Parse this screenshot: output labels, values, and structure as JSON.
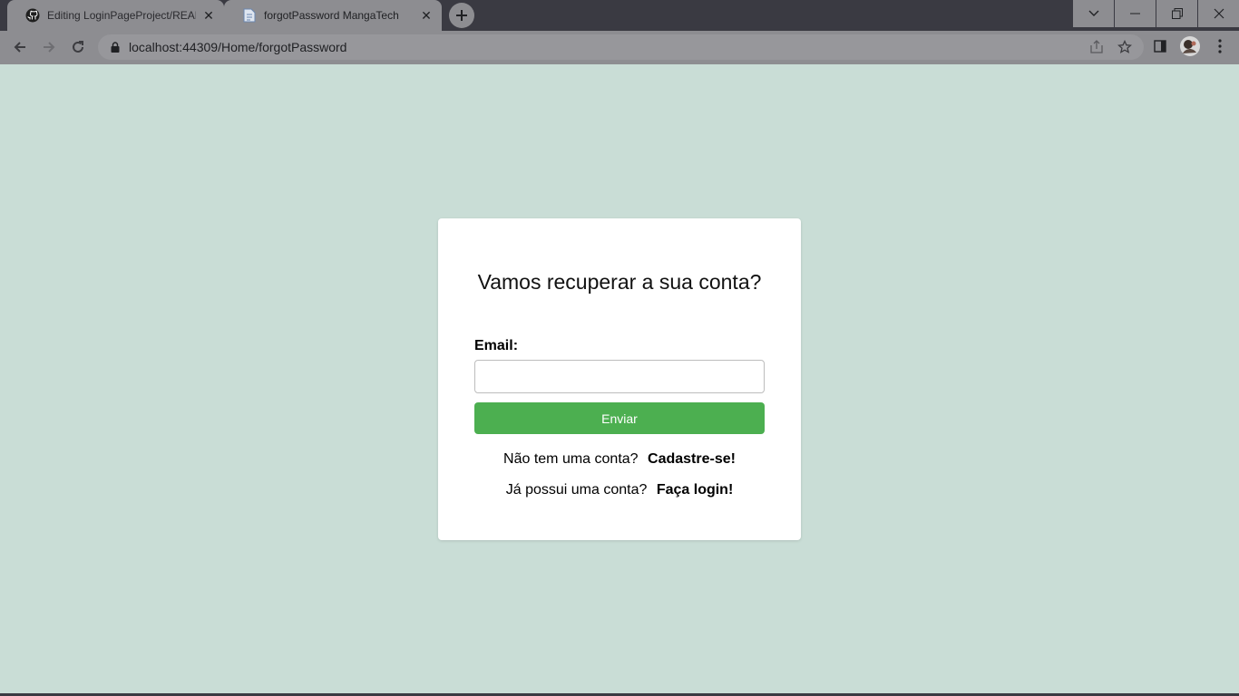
{
  "browser": {
    "tabs": [
      {
        "title": "Editing LoginPageProject/READM",
        "icon": "github-icon",
        "close": "✕"
      },
      {
        "title": "forgotPassword MangaTech",
        "icon": "page-icon",
        "close": "✕"
      }
    ],
    "url": "localhost:44309/Home/forgotPassword"
  },
  "form": {
    "title": "Vamos recuperar a sua conta?",
    "email_label": "Email:",
    "email_value": "",
    "submit_label": "Enviar",
    "signup_prompt": "Não tem uma conta?",
    "signup_link": "Cadastre-se!",
    "login_prompt": "Já possui uma conta?",
    "login_link": "Faça login!"
  },
  "colors": {
    "page_background": "#c9ddd6",
    "button": "#4caf50",
    "tab_strip": "#3a3a42",
    "toolbar": "#8d8d91"
  }
}
